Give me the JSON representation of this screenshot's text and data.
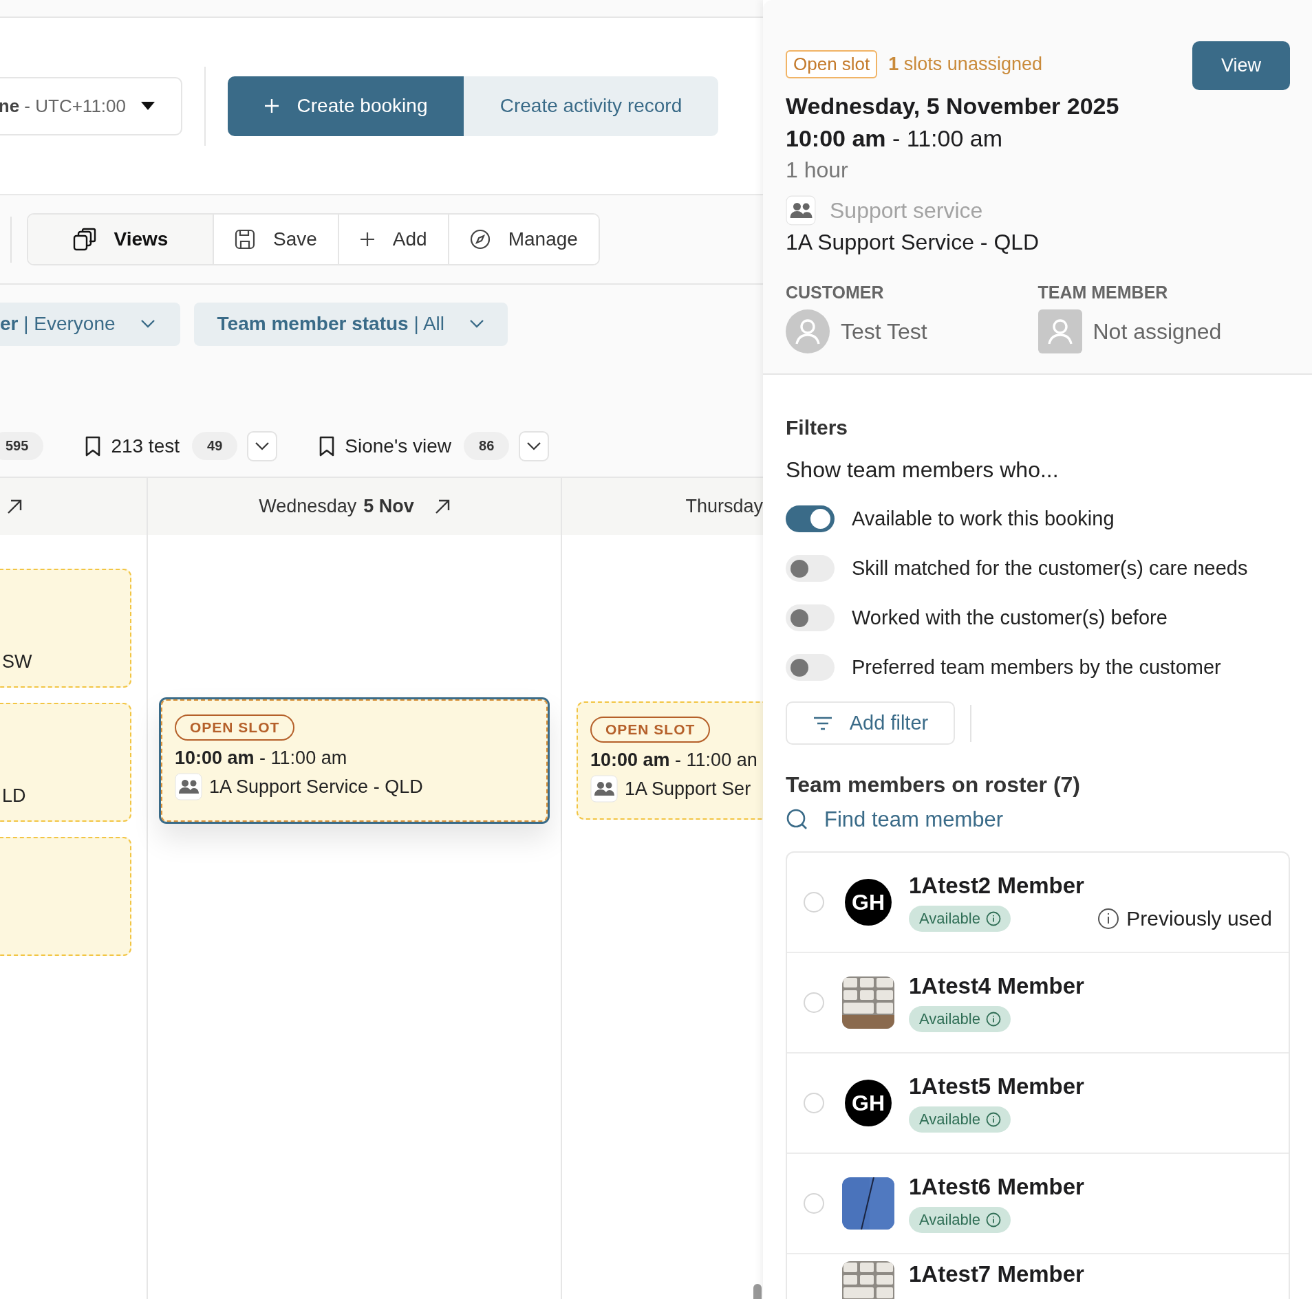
{
  "header": {
    "timezone": {
      "value": "**ne** - UTC+11:00"
    },
    "primary_button": "Create booking",
    "secondary_button": "Create activity record"
  },
  "toolbar": [
    {
      "label": "Views",
      "kind": "views",
      "selected": true
    },
    {
      "label": "Save",
      "kind": "save",
      "selected": false
    },
    {
      "label": "Add",
      "kind": "add",
      "selected": false
    },
    {
      "label": "Manage",
      "kind": "manage",
      "selected": false
    }
  ],
  "filters": [
    {
      "label": "**er** | Everyone"
    },
    {
      "label": "**Team member status** | All"
    }
  ],
  "saved_views": [
    {
      "count": "595"
    },
    {
      "label": "213 test",
      "count": "49"
    },
    {
      "label": "Sione's view",
      "count": "86"
    }
  ],
  "calendar": {
    "columns": [
      {
        "kind": "cut",
        "events": [
          {
            "text": "SW",
            "selected": false
          },
          {
            "text": "LD",
            "selected": false
          },
          {
            "selected": false
          }
        ]
      },
      {
        "kind": "day",
        "day": "Wednesday",
        "date": "5 Nov",
        "events": [
          {
            "badge": "OPEN SLOT",
            "time": "**10:00 am** - 11:00 am",
            "service": "1A Support Service - QLD",
            "selected": true
          }
        ]
      },
      {
        "kind": "day",
        "day": "Thursday",
        "events": [
          {
            "badge": "OPEN SLOT",
            "time": "**10:00 am** - 11:00 an",
            "service": "1A Support Ser",
            "selected": false
          }
        ]
      }
    ]
  },
  "booking": {
    "status": "Open slot",
    "unassigned": "**1** slots unassigned",
    "view_button": "View",
    "date": "Wednesday, 5 November 2025",
    "time": "**10:00 am** - 11:00 am",
    "duration": "1 hour",
    "service_label": "Support service",
    "service": "1A Support Service - QLD",
    "customer": {
      "label": "CUSTOMER",
      "name": "Test Test"
    },
    "team_member": {
      "label": "TEAM MEMBER",
      "name": "Not assigned"
    }
  },
  "filters_panel": {
    "title": "Filters",
    "subtitle": "Show team members who...",
    "toggles": [
      {
        "label": "Available to work this booking",
        "on": true
      },
      {
        "label": "Skill matched for the customer(s) care needs",
        "on": false
      },
      {
        "label": "Worked with the customer(s) before",
        "on": false
      },
      {
        "label": "Preferred team members by the customer",
        "on": false
      }
    ],
    "add_filter": "Add filter"
  },
  "roster": {
    "title": "Team members on roster (7)",
    "search": "Find team member",
    "members": [
      {
        "name": "1Atest2 Member",
        "avatar": {
          "kind": "initials",
          "initials": "GH"
        },
        "status": "Available",
        "note": "Previously used",
        "selected": false
      },
      {
        "name": "1Atest4 Member",
        "status": "Available",
        "selected": false
      },
      {
        "name": "1Atest5 Member",
        "avatar": {
          "kind": "initials",
          "initials": "GH"
        },
        "status": "Available",
        "selected": false
      },
      {
        "name": "1Atest6 Member",
        "status": "Available",
        "selected": false
      },
      {
        "name": "1Atest7 Member"
      }
    ]
  }
}
